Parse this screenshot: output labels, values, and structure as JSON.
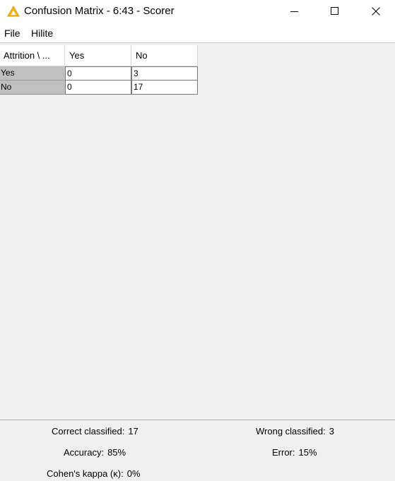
{
  "window": {
    "title": "Confusion Matrix - 6:43 - Scorer",
    "controls": [
      "minimize-icon",
      "maximize-icon",
      "close-icon"
    ]
  },
  "menu": {
    "file": "File",
    "hilite": "Hilite"
  },
  "matrix": {
    "corner_header": "Attrition \\ ...",
    "column_headers": [
      "Yes",
      "No"
    ],
    "rows": [
      {
        "label": "Yes",
        "values": [
          "0",
          "3"
        ]
      },
      {
        "label": "No",
        "values": [
          "0",
          "17"
        ]
      }
    ]
  },
  "stats": {
    "correct_label": "Correct classified:",
    "correct_value": "17",
    "wrong_label": "Wrong classified:",
    "wrong_value": "3",
    "accuracy_label": "Accuracy:",
    "accuracy_value": "85%",
    "error_label": "Error:",
    "error_value": "15%",
    "kappa_label": "Cohen's kappa (κ):",
    "kappa_value": "0%"
  },
  "colors": {
    "app_icon": "#f5b800",
    "row_header_bg": "#c0c0c0",
    "window_bg": "#f0f0f0"
  }
}
